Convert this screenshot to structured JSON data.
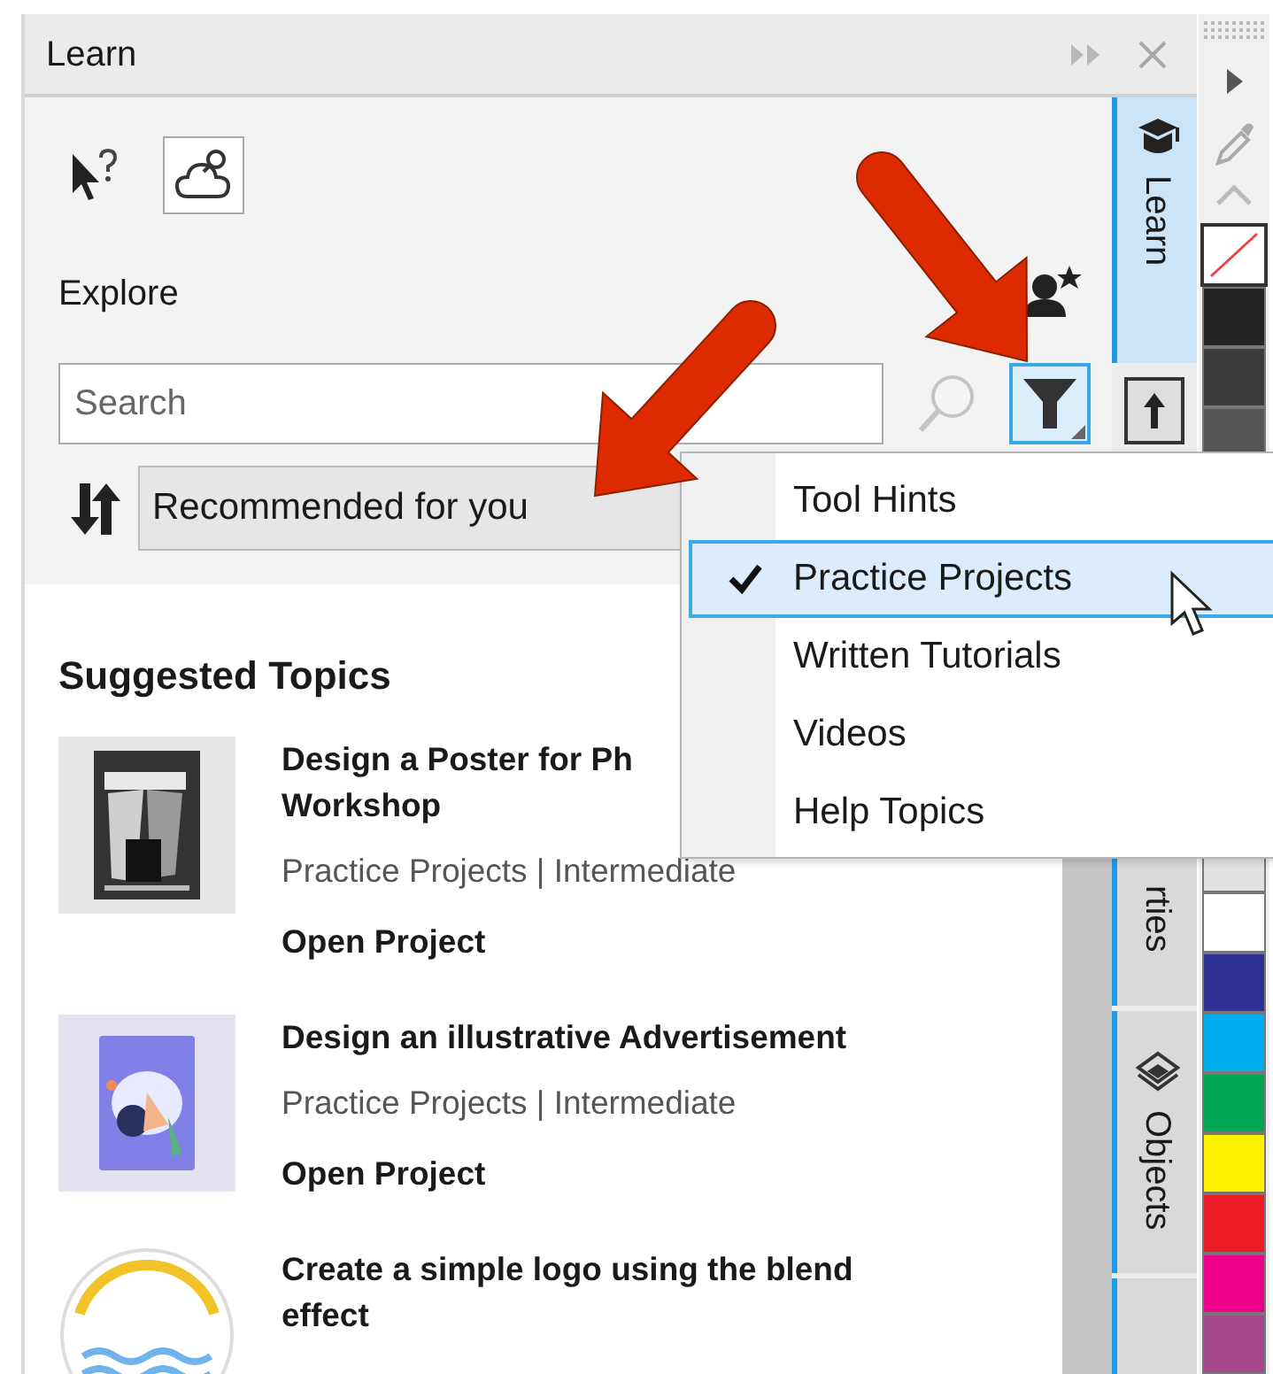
{
  "window": {
    "title": "Learn"
  },
  "explore": {
    "label": "Explore"
  },
  "search": {
    "placeholder": "Search"
  },
  "filter_button": {
    "pressed": true
  },
  "sort": {
    "value": "Recommended for you"
  },
  "filter_menu": [
    {
      "label": "Tool Hints",
      "checked": false,
      "selected": false
    },
    {
      "label": "Practice Projects",
      "checked": true,
      "selected": true
    },
    {
      "label": "Written Tutorials",
      "checked": false,
      "selected": false
    },
    {
      "label": "Videos",
      "checked": false,
      "selected": false
    },
    {
      "label": "Help Topics",
      "checked": false,
      "selected": false
    }
  ],
  "section_title": "Suggested Topics",
  "topics": [
    {
      "title": "Design a Poster for Ph\nWorkshop",
      "meta": "Practice Projects | Intermediate",
      "action": "Open Project"
    },
    {
      "title": "Design an illustrative Advertisement",
      "meta": "Practice Projects | Intermediate",
      "action": "Open Project"
    },
    {
      "title": "Create a simple logo using the blend\neffect"
    }
  ],
  "docker_tabs": [
    {
      "label": "Learn",
      "selected": true
    },
    {
      "label": "rties",
      "selected": false
    },
    {
      "label": "Objects",
      "selected": false
    }
  ],
  "palette_top": [
    {
      "kind": "none"
    },
    {
      "kind": "color",
      "color": "#222222"
    },
    {
      "kind": "color",
      "color": "#3c3c3c"
    },
    {
      "kind": "color",
      "color": "#555555"
    }
  ],
  "palette_bottom": [
    {
      "kind": "color",
      "color": "#e2e2e2"
    },
    {
      "kind": "color",
      "color": "#ffffff"
    },
    {
      "kind": "color",
      "color": "#2e3192"
    },
    {
      "kind": "color",
      "color": "#00aeef"
    },
    {
      "kind": "color",
      "color": "#00a651"
    },
    {
      "kind": "color",
      "color": "#fff200"
    },
    {
      "kind": "color",
      "color": "#ed1c24"
    },
    {
      "kind": "color",
      "color": "#ec008c"
    },
    {
      "kind": "color",
      "color": "#a3488c"
    }
  ]
}
